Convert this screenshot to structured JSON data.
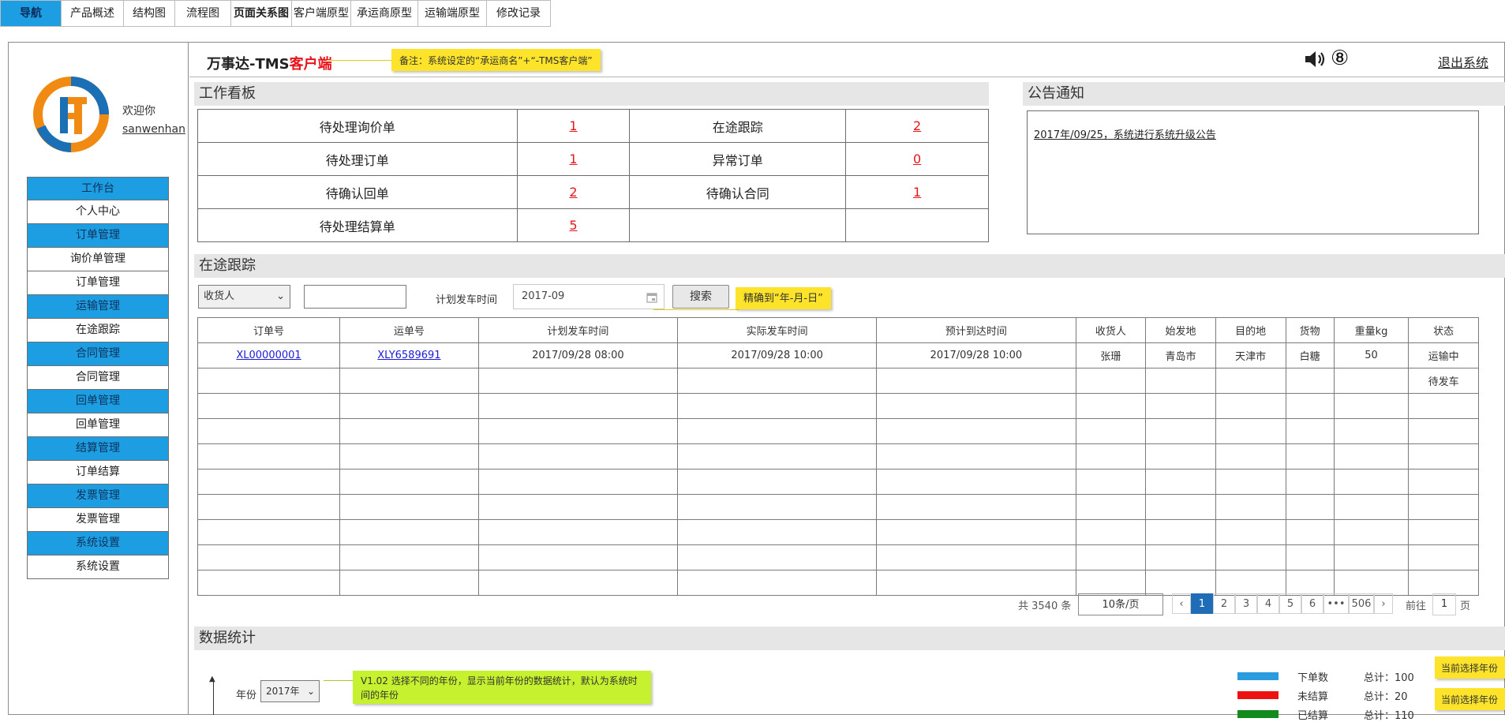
{
  "topnav": {
    "tabs": [
      "导航",
      "产品概述",
      "结构图",
      "流程图",
      "页面关系图",
      "客户端原型",
      "承运商原型",
      "运输端原型",
      "修改记录"
    ]
  },
  "sidebar": {
    "welcome": "欢迎你",
    "username": "sanwenhan",
    "menu": [
      {
        "label": "工作台",
        "type": "group"
      },
      {
        "label": "个人中心",
        "type": "sub"
      },
      {
        "label": "订单管理",
        "type": "group"
      },
      {
        "label": "询价单管理",
        "type": "sub"
      },
      {
        "label": "订单管理",
        "type": "sub"
      },
      {
        "label": "运输管理",
        "type": "group"
      },
      {
        "label": "在途跟踪",
        "type": "sub"
      },
      {
        "label": "合同管理",
        "type": "group"
      },
      {
        "label": "合同管理",
        "type": "sub"
      },
      {
        "label": "回单管理",
        "type": "group"
      },
      {
        "label": "回单管理",
        "type": "sub"
      },
      {
        "label": "结算管理",
        "type": "group"
      },
      {
        "label": "订单结算",
        "type": "sub"
      },
      {
        "label": "发票管理",
        "type": "group"
      },
      {
        "label": "发票管理",
        "type": "sub"
      },
      {
        "label": "系统设置",
        "type": "group"
      },
      {
        "label": "系统设置",
        "type": "sub"
      }
    ]
  },
  "header": {
    "title_prefix": "万事达-TMS",
    "title_suffix": "客户端",
    "note": "备注：系统设定的“承运商名”+“-TMS客户端”",
    "notification_count": "⑧",
    "logout": "退出系统"
  },
  "workboard": {
    "title": "工作看板",
    "rows": [
      {
        "label1": "待处理询价单",
        "value1": "1",
        "label2": "在途跟踪",
        "value2": "2"
      },
      {
        "label1": "待处理订单",
        "value1": "1",
        "label2": "异常订单",
        "value2": "0"
      },
      {
        "label1": "待确认回单",
        "value1": "2",
        "label2": "待确认合同",
        "value2": "1"
      },
      {
        "label1": "待处理结算单",
        "value1": "5",
        "label2": "",
        "value2": ""
      }
    ]
  },
  "notice": {
    "title": "公告通知",
    "items": [
      "2017年/09/25，系统进行系统升级公告"
    ]
  },
  "tracking": {
    "title": "在途跟踪",
    "filter_select": "收货人",
    "plan_label": "计划发车时间",
    "date_value": "2017-09",
    "search_button": "搜索",
    "date_note": "精确到“年-月-日”",
    "columns": [
      "订单号",
      "运单号",
      "计划发车时间",
      "实际发车时间",
      "预计到达时间",
      "收货人",
      "始发地",
      "目的地",
      "货物",
      "重量kg",
      "状态"
    ],
    "rows": [
      [
        "XL00000001",
        "XLY6589691",
        "2017/09/28 08:00",
        "2017/09/28 10:00",
        "2017/09/28 10:00",
        "张珊",
        "青岛市",
        "天津市",
        "白糖",
        "50",
        "运输中"
      ],
      [
        "",
        "",
        "",
        "",
        "",
        "",
        "",
        "",
        "",
        "",
        "待发车"
      ],
      [
        "",
        "",
        "",
        "",
        "",
        "",
        "",
        "",
        "",
        "",
        ""
      ],
      [
        "",
        "",
        "",
        "",
        "",
        "",
        "",
        "",
        "",
        "",
        ""
      ],
      [
        "",
        "",
        "",
        "",
        "",
        "",
        "",
        "",
        "",
        "",
        ""
      ],
      [
        "",
        "",
        "",
        "",
        "",
        "",
        "",
        "",
        "",
        "",
        ""
      ],
      [
        "",
        "",
        "",
        "",
        "",
        "",
        "",
        "",
        "",
        "",
        ""
      ],
      [
        "",
        "",
        "",
        "",
        "",
        "",
        "",
        "",
        "",
        "",
        ""
      ],
      [
        "",
        "",
        "",
        "",
        "",
        "",
        "",
        "",
        "",
        "",
        ""
      ],
      [
        "",
        "",
        "",
        "",
        "",
        "",
        "",
        "",
        "",
        "",
        ""
      ]
    ]
  },
  "pager": {
    "total": "共 3540 条",
    "page_size": "10条/页",
    "pages": [
      "1",
      "2",
      "3",
      "4",
      "5",
      "6",
      "•••",
      "506"
    ],
    "current": "1",
    "goto_label": "前往",
    "goto_value": "1",
    "page_unit": "页"
  },
  "stats": {
    "title": "数据统计",
    "year_label": "年份",
    "year_value": "2017年",
    "year_note": "V1.02 选择不同的年份，显示当前年份的数据统计，默认为系统时间的年份",
    "legend": [
      {
        "label": "下单数",
        "total": "总计：100",
        "color": "#2b9be0"
      },
      {
        "label": "未结算",
        "total": "总计：20",
        "color": "#ee1111"
      },
      {
        "label": "已结算",
        "total": "总计：110",
        "color": "#138a1d"
      }
    ],
    "right_note_1": "当前选择年份",
    "right_note_2": "当前选择年份"
  },
  "colors": {
    "accent_blue": "#1e9ee2",
    "note_yellow": "#fde42b",
    "note_green": "#c6f12e",
    "alert_red": "#e8141c"
  }
}
